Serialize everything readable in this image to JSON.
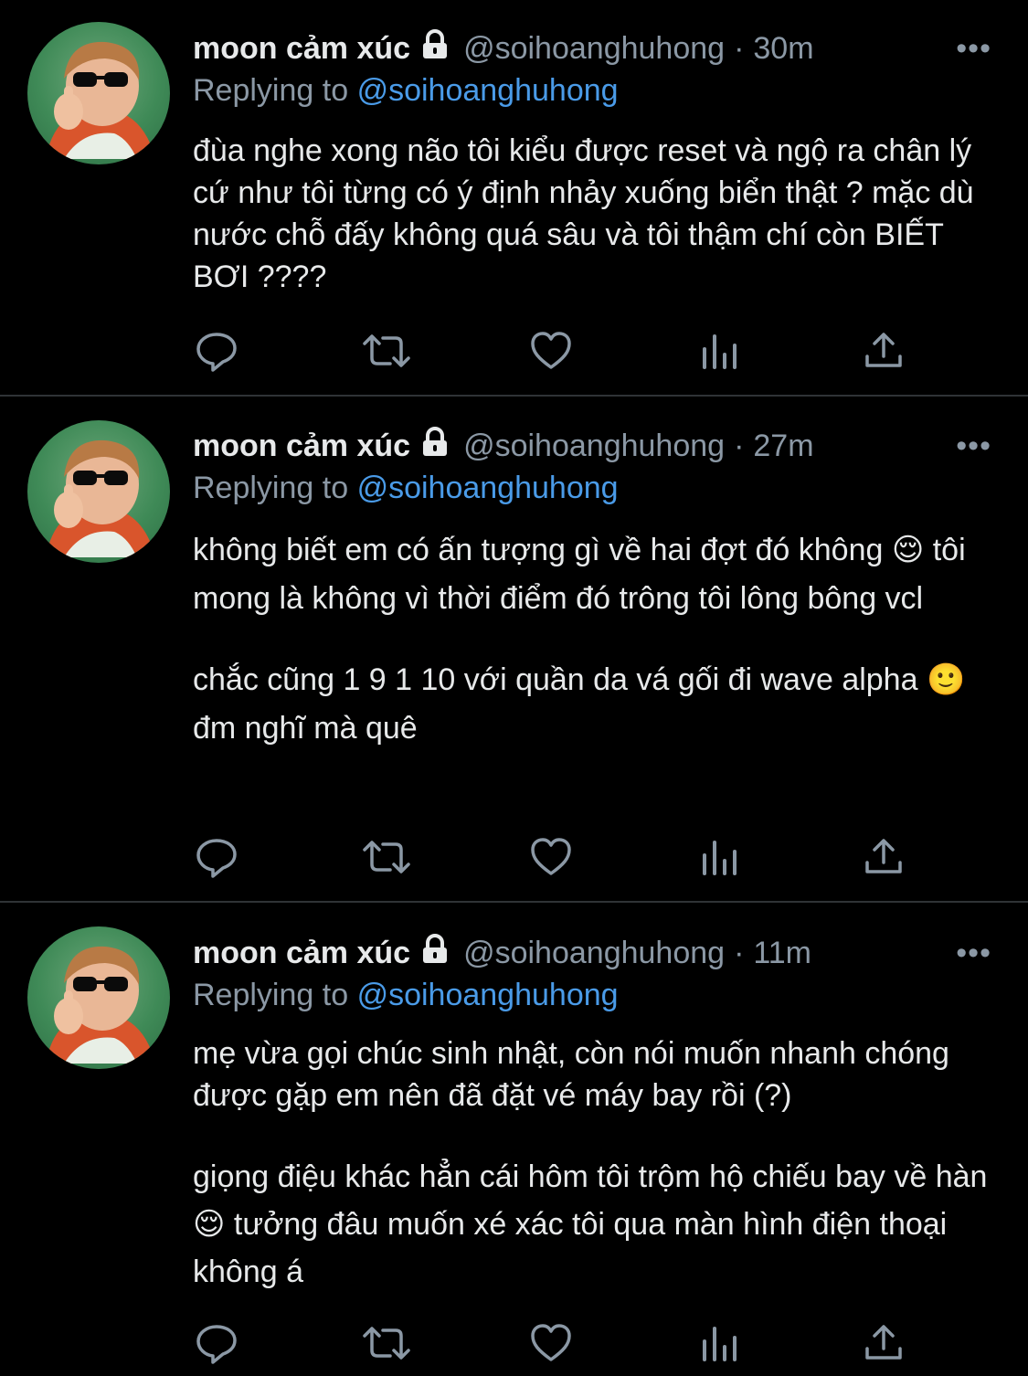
{
  "colors": {
    "background": "#000000",
    "text": "#e7e9ea",
    "muted": "#8b98a5",
    "mention": "#4a9be8",
    "divider": "#2f3336"
  },
  "tweets": [
    {
      "display_name": "moon cảm xúc",
      "handle": "@soihoanghuhong",
      "separator": "·",
      "time": "30m",
      "more": "•••",
      "replying_prefix": "Replying to",
      "replying_to": "@soihoanghuhong",
      "text": [
        "đùa nghe xong não tôi kiểu được reset và ngộ ra chân lý cứ như tôi từng có ý định nhảy xuống biển thật ? mặc dù nước chỗ đấy không quá sâu và tôi thậm chí còn BIẾT BƠI ????"
      ]
    },
    {
      "display_name": "moon cảm xúc",
      "handle": "@soihoanghuhong",
      "separator": "·",
      "time": "27m",
      "more": "•••",
      "replying_prefix": "Replying to",
      "replying_to": "@soihoanghuhong",
      "text": [
        "không biết em có ấn tượng gì về hai đợt đó không 😌 tôi mong là không vì thời điểm đó trông tôi lông bông vcl",
        "chắc cũng 1 9 1 10 với quần da vá gối đi wave alpha 🙂 đm nghĩ mà quê"
      ]
    },
    {
      "display_name": "moon cảm xúc",
      "handle": "@soihoanghuhong",
      "separator": "·",
      "time": "11m",
      "more": "•••",
      "replying_prefix": "Replying to",
      "replying_to": "@soihoanghuhong",
      "text": [
        "mẹ vừa gọi chúc sinh nhật, còn nói muốn nhanh chóng được gặp em nên đã đặt vé máy bay rồi (?)",
        "giọng điệu khác hẳn cái hôm tôi trộm hộ chiếu bay về hàn 😌 tưởng đâu muốn xé xác tôi qua màn hình điện thoại không á"
      ]
    }
  ],
  "icons": {
    "lock": "lock-icon",
    "reply": "reply-icon",
    "retweet": "retweet-icon",
    "like": "like-icon",
    "analytics": "analytics-icon",
    "share": "share-icon"
  }
}
